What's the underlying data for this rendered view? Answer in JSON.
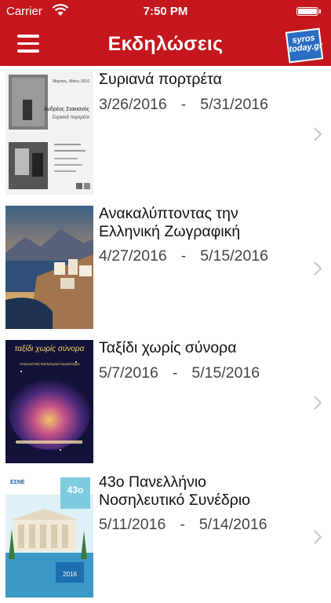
{
  "status_bar": {
    "carrier": "Carrier",
    "time": "7:50 PM"
  },
  "nav": {
    "title": "Εκδηλώσεις",
    "logo_text": "syros today.gr",
    "accent_color": "#c4161c"
  },
  "events": [
    {
      "title": "Συριανά πορτρέτα",
      "start": "3/26/2016",
      "end": "5/31/2016",
      "date_sep": "-",
      "poster": {
        "top_right": "Μάρτιος, Μάιος 2016",
        "artist": "Ανδρέας Σιακιανός",
        "subtitle": "Συριανά πορτρέτα"
      }
    },
    {
      "title": "Ανακαλύπτοντας την Ελληνική Ζωγραφική",
      "start": "4/27/2016",
      "end": "5/15/2016",
      "date_sep": "-"
    },
    {
      "title": "Ταξίδι χωρίς σύνορα",
      "start": "5/7/2016",
      "end": "5/15/2016",
      "date_sep": "-",
      "poster": {
        "heading": "ταξίδι χωρίς σύνορα",
        "subheading": "Αναγνωστική Καλλιτεχνικό Εργαστήριο"
      }
    },
    {
      "title": "43ο Πανελλήνιο Νοσηλευτικό Συνέδριο",
      "start": "5/11/2016",
      "end": "5/14/2016",
      "date_sep": "-",
      "poster": {
        "number": "43ο",
        "org": "ΕΣΝΕ",
        "year": "2016"
      }
    }
  ],
  "icons": {
    "menu": "hamburger-menu-icon",
    "chevron": "chevron-right-icon",
    "wifi": "wifi-icon",
    "battery": "battery-icon"
  }
}
